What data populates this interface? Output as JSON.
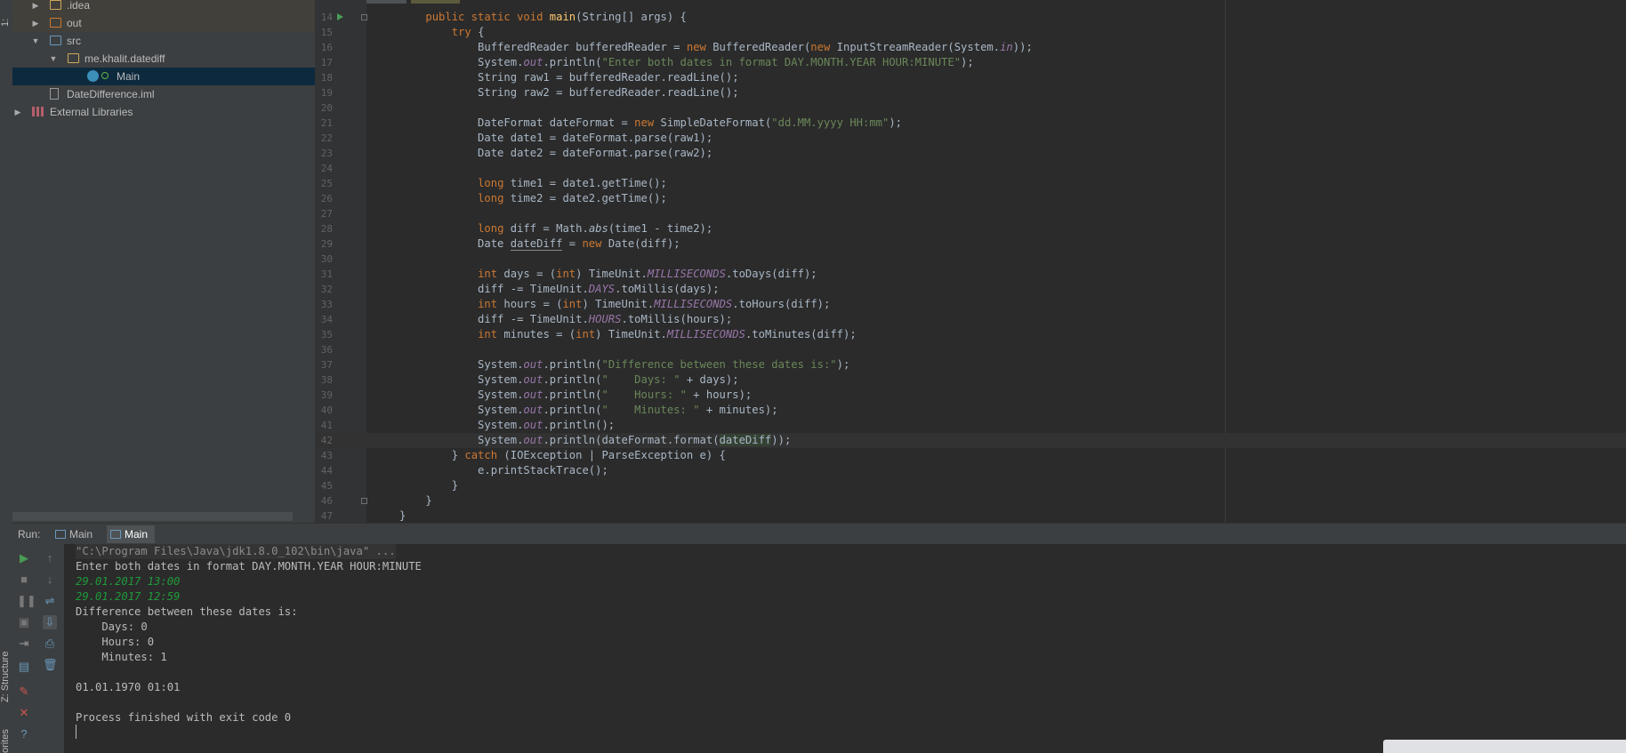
{
  "left_strip": {
    "tabs": [
      "1:",
      "Z: Structure",
      "orites"
    ]
  },
  "project_tree": [
    {
      "label": ".idea",
      "kind": "folder",
      "expanded": false
    },
    {
      "label": "out",
      "kind": "folder-orange",
      "expanded": false
    },
    {
      "label": "src",
      "kind": "folder-blue",
      "expanded": true
    },
    {
      "label": "me.khalit.datediff",
      "kind": "package",
      "expanded": true
    },
    {
      "label": "Main",
      "kind": "class"
    },
    {
      "label": "DateDifference.iml",
      "kind": "file"
    },
    {
      "label": "External Libraries",
      "kind": "library",
      "expanded": false
    }
  ],
  "editor": {
    "line_numbers": [
      "14",
      "15",
      "16",
      "17",
      "18",
      "19",
      "20",
      "21",
      "22",
      "23",
      "24",
      "25",
      "26",
      "27",
      "28",
      "29",
      "30",
      "31",
      "32",
      "33",
      "34",
      "35",
      "36",
      "37",
      "38",
      "39",
      "40",
      "41",
      "42",
      "43",
      "44",
      "45",
      "46",
      "47"
    ]
  },
  "run": {
    "title": "Run:",
    "tabs": [
      "Main",
      "Main"
    ],
    "toolbar_icons": [
      "run-icon",
      "stop-icon",
      "pause-icon",
      "dump-icon",
      "exit-icon",
      "layout-icon",
      "pin-icon",
      "close-icon",
      "help-icon"
    ],
    "toolbar2_icons": [
      "up-icon",
      "down-icon",
      "wrap-icon",
      "scroll-icon",
      "print-icon",
      "trash-icon"
    ],
    "console": [
      {
        "text": "\"C:\\Program Files\\Java\\jdk1.8.0_102\\bin\\java\" ...",
        "type": "cmd"
      },
      {
        "text": "Enter both dates in format DAY.MONTH.YEAR HOUR:MINUTE",
        "type": "out"
      },
      {
        "text": "29.01.2017 13:00",
        "type": "input"
      },
      {
        "text": "29.01.2017 12:59",
        "type": "input"
      },
      {
        "text": "Difference between these dates is:",
        "type": "out"
      },
      {
        "text": "    Days: 0",
        "type": "out"
      },
      {
        "text": "    Hours: 0",
        "type": "out"
      },
      {
        "text": "    Minutes: 1",
        "type": "out"
      },
      {
        "text": "",
        "type": "out"
      },
      {
        "text": "01.01.1970 01:01",
        "type": "out"
      },
      {
        "text": "",
        "type": "out"
      },
      {
        "text": "Process finished with exit code 0",
        "type": "out"
      }
    ]
  },
  "colors": {
    "keyword": "#cc7832",
    "string": "#6a8759",
    "static_field": "#9876aa",
    "method_decl": "#ffc66d",
    "input_text": "#1f9b3a",
    "background": "#2b2b2b",
    "panel": "#3c3f41"
  }
}
